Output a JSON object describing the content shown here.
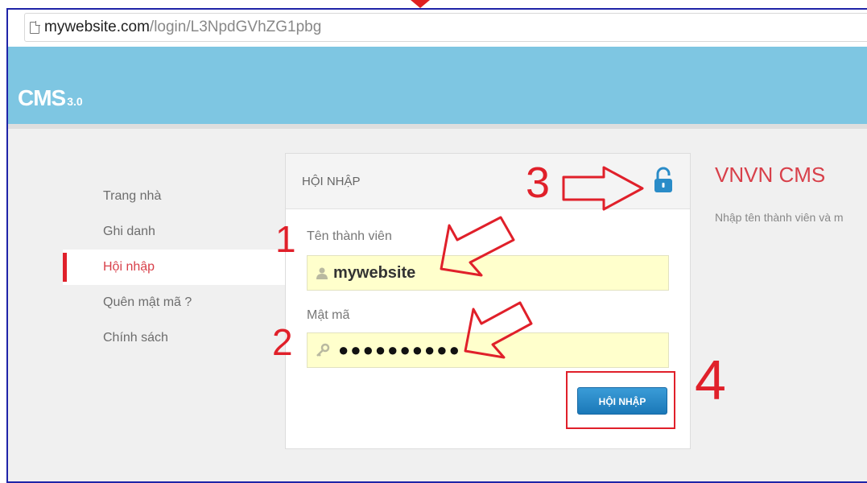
{
  "browser": {
    "url_host": "mywebsite.com",
    "url_path": "/login/L3NpdGVhZG1pbg"
  },
  "header": {
    "logo_main": "CMS",
    "logo_version": "3.0"
  },
  "sidebar": {
    "items": [
      {
        "label": "Trang nhà"
      },
      {
        "label": "Ghi danh"
      },
      {
        "label": "Hội nhập"
      },
      {
        "label": "Quên mật mã ?"
      },
      {
        "label": "Chính sách"
      }
    ]
  },
  "login_panel": {
    "title": "HỘI NHẬP",
    "username_label": "Tên thành viên",
    "username_value": "mywebsite",
    "password_label": "Mật mã",
    "password_value": "●●●●●●●●●●",
    "submit_label": "HỘI NHẬP"
  },
  "info": {
    "title": "VNVN CMS",
    "text": "Nhập tên thành viên và m"
  },
  "annotations": {
    "step1": "1",
    "step2": "2",
    "step3": "3",
    "step4": "4"
  },
  "colors": {
    "accent_red": "#e0202a",
    "header_blue": "#7ec6e2",
    "button_blue": "#1b78b8",
    "input_yellow": "#ffffcc",
    "frame_border": "#1f24a8"
  }
}
